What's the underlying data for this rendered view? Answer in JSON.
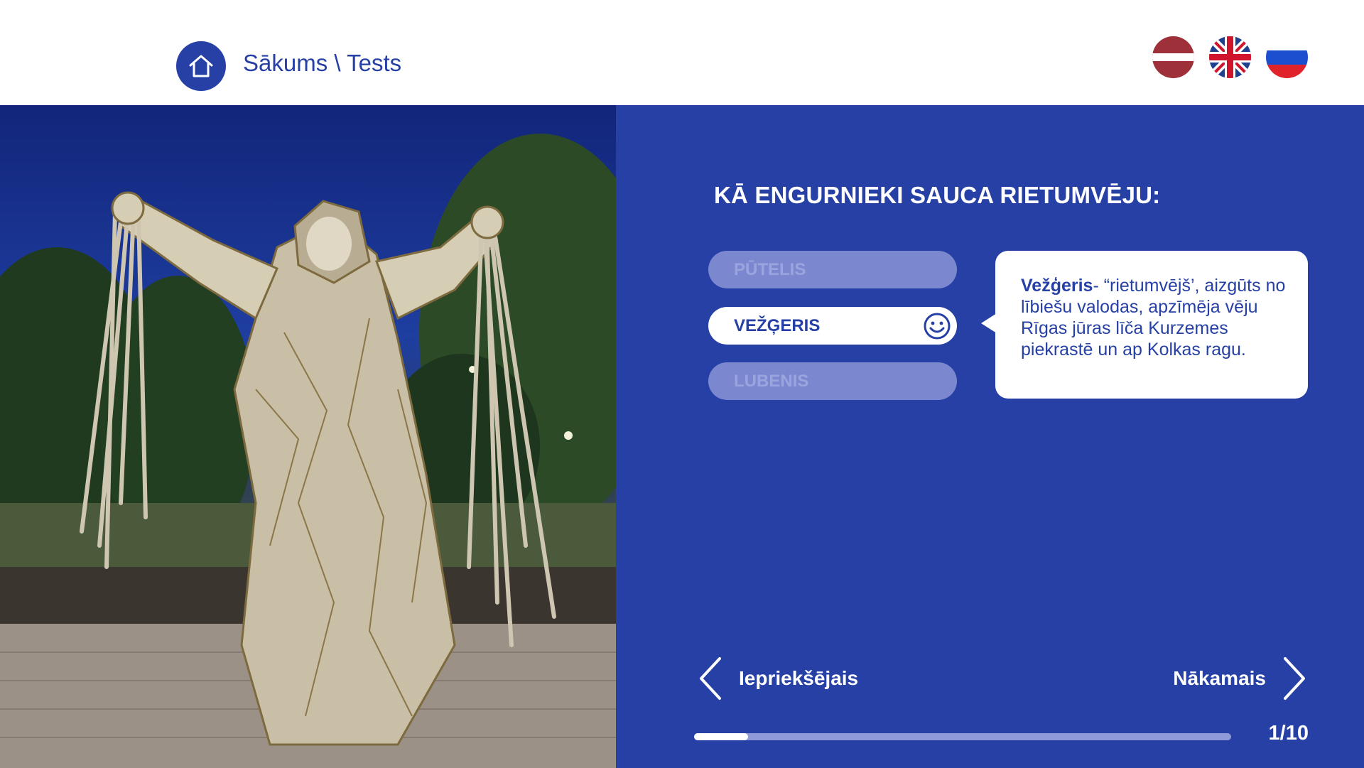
{
  "header": {
    "breadcrumb": {
      "home": "Sākums",
      "separator": " \\ ",
      "current": "Tests"
    },
    "languages": [
      {
        "code": "lv",
        "icon": "latvia-flag-icon"
      },
      {
        "code": "en",
        "icon": "uk-flag-icon"
      },
      {
        "code": "ru",
        "icon": "russia-flag-icon"
      }
    ]
  },
  "photo": {
    "subject": "Illuminated metal sculpture of a hooded wind god holding bundles of rods, park at dusk"
  },
  "quiz": {
    "question": "KĀ ENGURNIEKI SAUCA RIETUMVĒJU:",
    "answers": [
      {
        "label": "PŪTELIS",
        "selected": false
      },
      {
        "label": "VEŽĢERIS",
        "selected": true,
        "icon": "smiley-icon"
      },
      {
        "label": "LUBENIS",
        "selected": false
      }
    ],
    "explanation": {
      "term": "Vežģeris",
      "text": "- “rietumvējš’, aizgūts no lībiešu valodas, apzīmēja vēju Rīgas jūras līča Kurzemes piekrastē un ap Kolkas ragu."
    }
  },
  "navigation": {
    "prev_label": "Iepriekšējais",
    "next_label": "Nākamais"
  },
  "progress": {
    "current": 1,
    "total": 10,
    "label": "1/10"
  },
  "colors": {
    "brand_blue": "#2640a6",
    "inactive_answer": "#7b88d0",
    "progress_track": "#8e9ad9",
    "white": "#ffffff"
  }
}
